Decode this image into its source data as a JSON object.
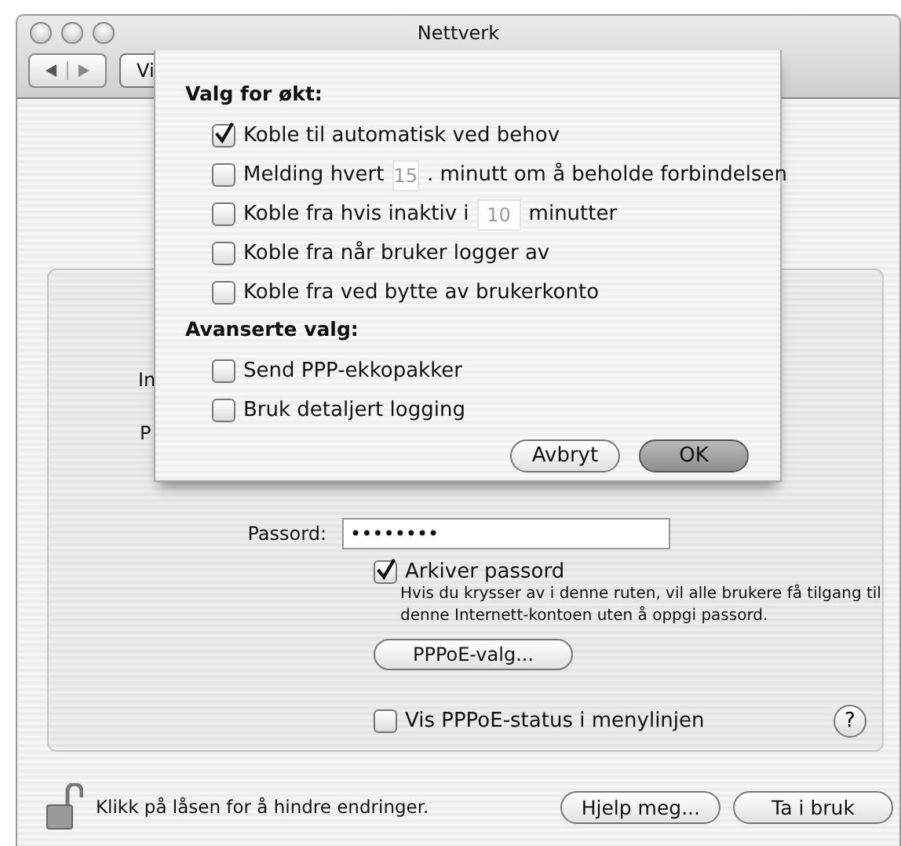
{
  "window": {
    "title": "Nettverk"
  },
  "toolbar": {
    "show_all_button": "Vi"
  },
  "form": {
    "partial_labels": [
      "In",
      "P"
    ],
    "password": {
      "label": "Passord:",
      "value": "••••••••"
    },
    "save_password": {
      "label": "Arkiver passord",
      "checked": true,
      "help": "Hvis du krysser av i denne ruten, vil alle brukere få tilgang til denne Internett-kontoen uten å oppgi passord."
    },
    "options_button": "PPPoE-valg...",
    "show_status": {
      "label": "Vis PPPoE-status i menylinjen",
      "checked": false
    },
    "help_button": "?"
  },
  "footer": {
    "lock_text": "Klikk på låsen for å hindre endringer.",
    "buttons": [
      "Hjelp meg...",
      "Ta i bruk"
    ]
  },
  "sheet": {
    "sections": [
      {
        "heading": "Valg for økt:",
        "options": [
          {
            "kind": "check",
            "label": "Koble til automatisk ved behov",
            "checked": true
          },
          {
            "kind": "field",
            "before": "Melding hvert",
            "value": "15",
            "after": ". minutt om å beholde forbindelsen",
            "checked": false
          },
          {
            "kind": "field",
            "before": "Koble fra hvis inaktiv i",
            "value": "10",
            "after": "minutter",
            "checked": false
          },
          {
            "kind": "check",
            "label": "Koble fra når bruker logger av",
            "checked": false
          },
          {
            "kind": "check",
            "label": "Koble fra ved bytte av brukerkonto",
            "checked": false
          }
        ]
      },
      {
        "heading": "Avanserte valg:",
        "options": [
          {
            "kind": "check",
            "label": "Send PPP-ekkopakker",
            "checked": false
          },
          {
            "kind": "check",
            "label": "Bruk detaljert logging",
            "checked": false
          }
        ]
      }
    ],
    "buttons": [
      {
        "label": "Avbryt",
        "default": false
      },
      {
        "label": "OK",
        "default": true
      }
    ]
  }
}
